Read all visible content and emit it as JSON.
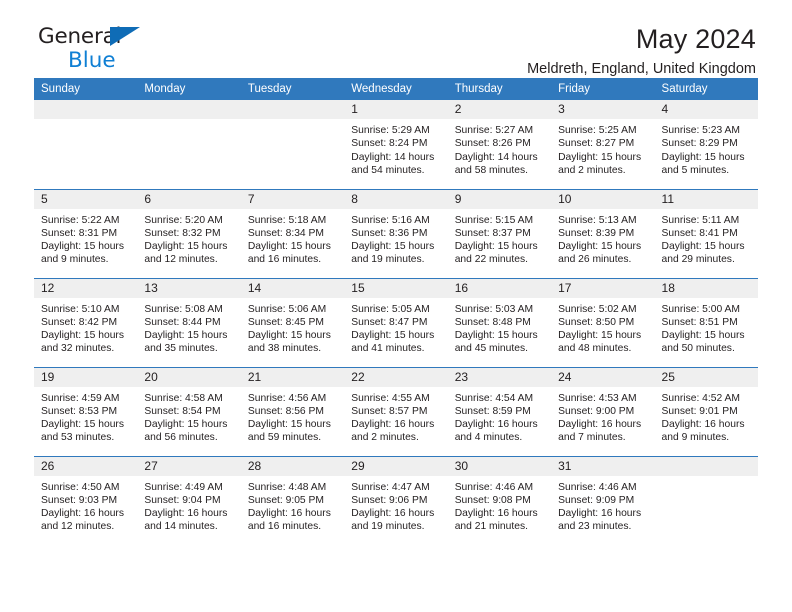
{
  "brand": {
    "name_top": "General",
    "name_bottom": "Blue",
    "accent_color": "#0f7fd4",
    "triangle_color": "#0f6cb6"
  },
  "header": {
    "title": "May 2024",
    "subtitle": "Meldreth, England, United Kingdom"
  },
  "theme": {
    "header_bg": "#3079bd",
    "daynum_bg": "#efefef",
    "text_color": "#231f20",
    "cell_bg": "#ffffff"
  },
  "weekdays": [
    "Sunday",
    "Monday",
    "Tuesday",
    "Wednesday",
    "Thursday",
    "Friday",
    "Saturday"
  ],
  "labels": {
    "sunrise": "Sunrise:",
    "sunset": "Sunset:",
    "daylight": "Daylight:"
  },
  "weeks": [
    [
      {
        "day": "",
        "sunrise": "",
        "sunset": "",
        "daylight1": "",
        "daylight2": ""
      },
      {
        "day": "",
        "sunrise": "",
        "sunset": "",
        "daylight1": "",
        "daylight2": ""
      },
      {
        "day": "",
        "sunrise": "",
        "sunset": "",
        "daylight1": "",
        "daylight2": ""
      },
      {
        "day": "1",
        "sunrise": "Sunrise: 5:29 AM",
        "sunset": "Sunset: 8:24 PM",
        "daylight1": "Daylight: 14 hours",
        "daylight2": "and 54 minutes."
      },
      {
        "day": "2",
        "sunrise": "Sunrise: 5:27 AM",
        "sunset": "Sunset: 8:26 PM",
        "daylight1": "Daylight: 14 hours",
        "daylight2": "and 58 minutes."
      },
      {
        "day": "3",
        "sunrise": "Sunrise: 5:25 AM",
        "sunset": "Sunset: 8:27 PM",
        "daylight1": "Daylight: 15 hours",
        "daylight2": "and 2 minutes."
      },
      {
        "day": "4",
        "sunrise": "Sunrise: 5:23 AM",
        "sunset": "Sunset: 8:29 PM",
        "daylight1": "Daylight: 15 hours",
        "daylight2": "and 5 minutes."
      }
    ],
    [
      {
        "day": "5",
        "sunrise": "Sunrise: 5:22 AM",
        "sunset": "Sunset: 8:31 PM",
        "daylight1": "Daylight: 15 hours",
        "daylight2": "and 9 minutes."
      },
      {
        "day": "6",
        "sunrise": "Sunrise: 5:20 AM",
        "sunset": "Sunset: 8:32 PM",
        "daylight1": "Daylight: 15 hours",
        "daylight2": "and 12 minutes."
      },
      {
        "day": "7",
        "sunrise": "Sunrise: 5:18 AM",
        "sunset": "Sunset: 8:34 PM",
        "daylight1": "Daylight: 15 hours",
        "daylight2": "and 16 minutes."
      },
      {
        "day": "8",
        "sunrise": "Sunrise: 5:16 AM",
        "sunset": "Sunset: 8:36 PM",
        "daylight1": "Daylight: 15 hours",
        "daylight2": "and 19 minutes."
      },
      {
        "day": "9",
        "sunrise": "Sunrise: 5:15 AM",
        "sunset": "Sunset: 8:37 PM",
        "daylight1": "Daylight: 15 hours",
        "daylight2": "and 22 minutes."
      },
      {
        "day": "10",
        "sunrise": "Sunrise: 5:13 AM",
        "sunset": "Sunset: 8:39 PM",
        "daylight1": "Daylight: 15 hours",
        "daylight2": "and 26 minutes."
      },
      {
        "day": "11",
        "sunrise": "Sunrise: 5:11 AM",
        "sunset": "Sunset: 8:41 PM",
        "daylight1": "Daylight: 15 hours",
        "daylight2": "and 29 minutes."
      }
    ],
    [
      {
        "day": "12",
        "sunrise": "Sunrise: 5:10 AM",
        "sunset": "Sunset: 8:42 PM",
        "daylight1": "Daylight: 15 hours",
        "daylight2": "and 32 minutes."
      },
      {
        "day": "13",
        "sunrise": "Sunrise: 5:08 AM",
        "sunset": "Sunset: 8:44 PM",
        "daylight1": "Daylight: 15 hours",
        "daylight2": "and 35 minutes."
      },
      {
        "day": "14",
        "sunrise": "Sunrise: 5:06 AM",
        "sunset": "Sunset: 8:45 PM",
        "daylight1": "Daylight: 15 hours",
        "daylight2": "and 38 minutes."
      },
      {
        "day": "15",
        "sunrise": "Sunrise: 5:05 AM",
        "sunset": "Sunset: 8:47 PM",
        "daylight1": "Daylight: 15 hours",
        "daylight2": "and 41 minutes."
      },
      {
        "day": "16",
        "sunrise": "Sunrise: 5:03 AM",
        "sunset": "Sunset: 8:48 PM",
        "daylight1": "Daylight: 15 hours",
        "daylight2": "and 45 minutes."
      },
      {
        "day": "17",
        "sunrise": "Sunrise: 5:02 AM",
        "sunset": "Sunset: 8:50 PM",
        "daylight1": "Daylight: 15 hours",
        "daylight2": "and 48 minutes."
      },
      {
        "day": "18",
        "sunrise": "Sunrise: 5:00 AM",
        "sunset": "Sunset: 8:51 PM",
        "daylight1": "Daylight: 15 hours",
        "daylight2": "and 50 minutes."
      }
    ],
    [
      {
        "day": "19",
        "sunrise": "Sunrise: 4:59 AM",
        "sunset": "Sunset: 8:53 PM",
        "daylight1": "Daylight: 15 hours",
        "daylight2": "and 53 minutes."
      },
      {
        "day": "20",
        "sunrise": "Sunrise: 4:58 AM",
        "sunset": "Sunset: 8:54 PM",
        "daylight1": "Daylight: 15 hours",
        "daylight2": "and 56 minutes."
      },
      {
        "day": "21",
        "sunrise": "Sunrise: 4:56 AM",
        "sunset": "Sunset: 8:56 PM",
        "daylight1": "Daylight: 15 hours",
        "daylight2": "and 59 minutes."
      },
      {
        "day": "22",
        "sunrise": "Sunrise: 4:55 AM",
        "sunset": "Sunset: 8:57 PM",
        "daylight1": "Daylight: 16 hours",
        "daylight2": "and 2 minutes."
      },
      {
        "day": "23",
        "sunrise": "Sunrise: 4:54 AM",
        "sunset": "Sunset: 8:59 PM",
        "daylight1": "Daylight: 16 hours",
        "daylight2": "and 4 minutes."
      },
      {
        "day": "24",
        "sunrise": "Sunrise: 4:53 AM",
        "sunset": "Sunset: 9:00 PM",
        "daylight1": "Daylight: 16 hours",
        "daylight2": "and 7 minutes."
      },
      {
        "day": "25",
        "sunrise": "Sunrise: 4:52 AM",
        "sunset": "Sunset: 9:01 PM",
        "daylight1": "Daylight: 16 hours",
        "daylight2": "and 9 minutes."
      }
    ],
    [
      {
        "day": "26",
        "sunrise": "Sunrise: 4:50 AM",
        "sunset": "Sunset: 9:03 PM",
        "daylight1": "Daylight: 16 hours",
        "daylight2": "and 12 minutes."
      },
      {
        "day": "27",
        "sunrise": "Sunrise: 4:49 AM",
        "sunset": "Sunset: 9:04 PM",
        "daylight1": "Daylight: 16 hours",
        "daylight2": "and 14 minutes."
      },
      {
        "day": "28",
        "sunrise": "Sunrise: 4:48 AM",
        "sunset": "Sunset: 9:05 PM",
        "daylight1": "Daylight: 16 hours",
        "daylight2": "and 16 minutes."
      },
      {
        "day": "29",
        "sunrise": "Sunrise: 4:47 AM",
        "sunset": "Sunset: 9:06 PM",
        "daylight1": "Daylight: 16 hours",
        "daylight2": "and 19 minutes."
      },
      {
        "day": "30",
        "sunrise": "Sunrise: 4:46 AM",
        "sunset": "Sunset: 9:08 PM",
        "daylight1": "Daylight: 16 hours",
        "daylight2": "and 21 minutes."
      },
      {
        "day": "31",
        "sunrise": "Sunrise: 4:46 AM",
        "sunset": "Sunset: 9:09 PM",
        "daylight1": "Daylight: 16 hours",
        "daylight2": "and 23 minutes."
      },
      {
        "day": "",
        "sunrise": "",
        "sunset": "",
        "daylight1": "",
        "daylight2": ""
      }
    ]
  ]
}
